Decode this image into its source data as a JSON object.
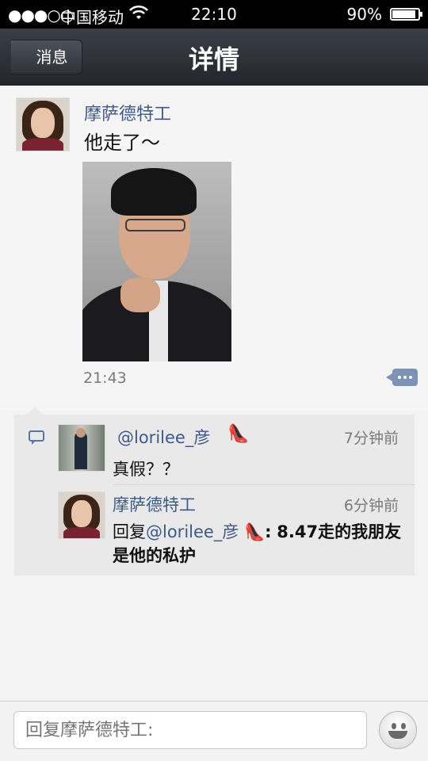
{
  "status_bar": {
    "signal": "●●●○○",
    "carrier": "中国移动",
    "time": "22:10",
    "battery_percent": "90%",
    "battery_level": 0.9
  },
  "nav": {
    "back_label": "消息",
    "title": "详情"
  },
  "post": {
    "author": "摩萨德特工",
    "text": "他走了～",
    "time": "21:43"
  },
  "comments": [
    {
      "name": "@lorilee_彦",
      "time": "7分钟前",
      "body": "真假？？",
      "badge_icon": "high-heel-icon"
    },
    {
      "name": "摩萨德特工",
      "time": "6分钟前",
      "reply_prefix": "回复",
      "reply_mention": "@lorilee_彦",
      "reply_text": "8.47走的我朋友是他的私护",
      "reply_colon": ":"
    }
  ],
  "input": {
    "placeholder": "回复摩萨德特工:"
  },
  "colors": {
    "link": "#3c5a8a",
    "nav_bg": "#2b3036",
    "accent_icon": "#7c93b6"
  }
}
